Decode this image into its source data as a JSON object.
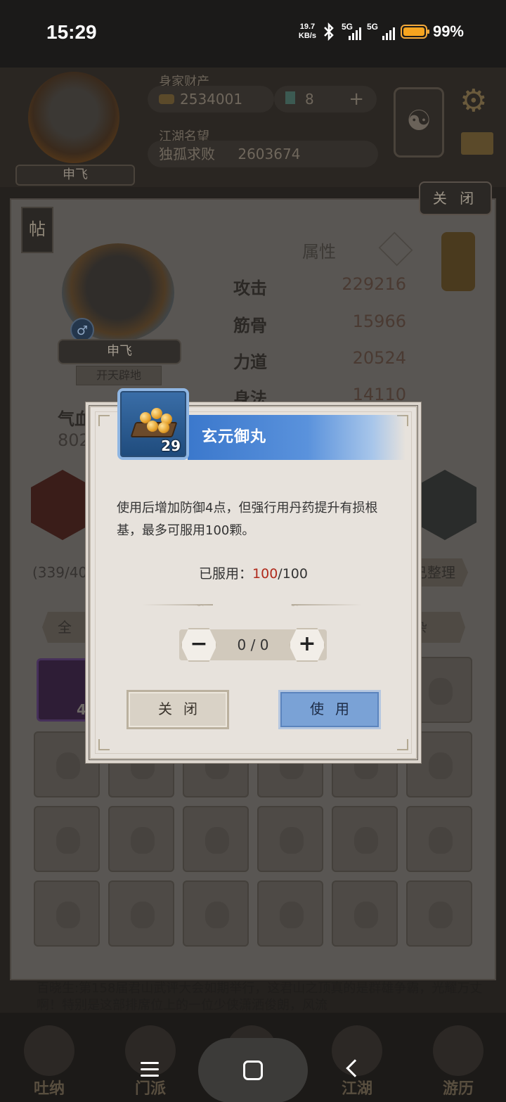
{
  "status_bar": {
    "time": "15:29",
    "net_speed_value": "19.7",
    "net_speed_unit": "KB/s",
    "sim1": "5G",
    "sim2": "5G",
    "battery_pct": "99%",
    "battery_level": 0.99
  },
  "header": {
    "player_name": "申飞",
    "wealth_label": "身家财产",
    "gold": "2534001",
    "gems": "8",
    "add": "+",
    "fame_label": "江湖名望",
    "fame_title": "独孤求败",
    "fame_value": "2603674"
  },
  "panel": {
    "close_label": "关 闭",
    "tie_label": "帖",
    "char_name": "申飞",
    "char_title": "开天辟地",
    "gender": "♂",
    "attr_header": "属性",
    "attributes": [
      {
        "name": "攻击",
        "value": "229216"
      },
      {
        "name": "筋骨",
        "value": "15966"
      },
      {
        "name": "力道",
        "value": "20524"
      },
      {
        "name": "身法",
        "value": "14110"
      }
    ],
    "hp_label": "气血",
    "hp_value": "802",
    "bag_count": "(339/408",
    "tidy_label": "已整理",
    "tab_all": "全 部",
    "tab_misc": "杂 物",
    "special_item_count": "49",
    "news": "百晓生:第158届君山武评大会如期举行，这君山之顶真的是群雄争霸，光耀万丈啊！特别是这部排席位上的一位少侠潇洒俊朗，风流"
  },
  "bottom_nav": [
    "吐纳",
    "门派",
    "武学",
    "江湖",
    "游历"
  ],
  "dialog": {
    "item_name": "玄元御丸",
    "item_count": "29",
    "description": "使用后增加防御4点，但强行用丹药提升有损根基，最多可服用100颗。",
    "used_label": "已服用：",
    "used_current": "100",
    "used_max": "/100",
    "stepper_value": "0 / 0",
    "minus": "−",
    "plus": "+",
    "close_label": "关闭",
    "use_label": "使用"
  }
}
